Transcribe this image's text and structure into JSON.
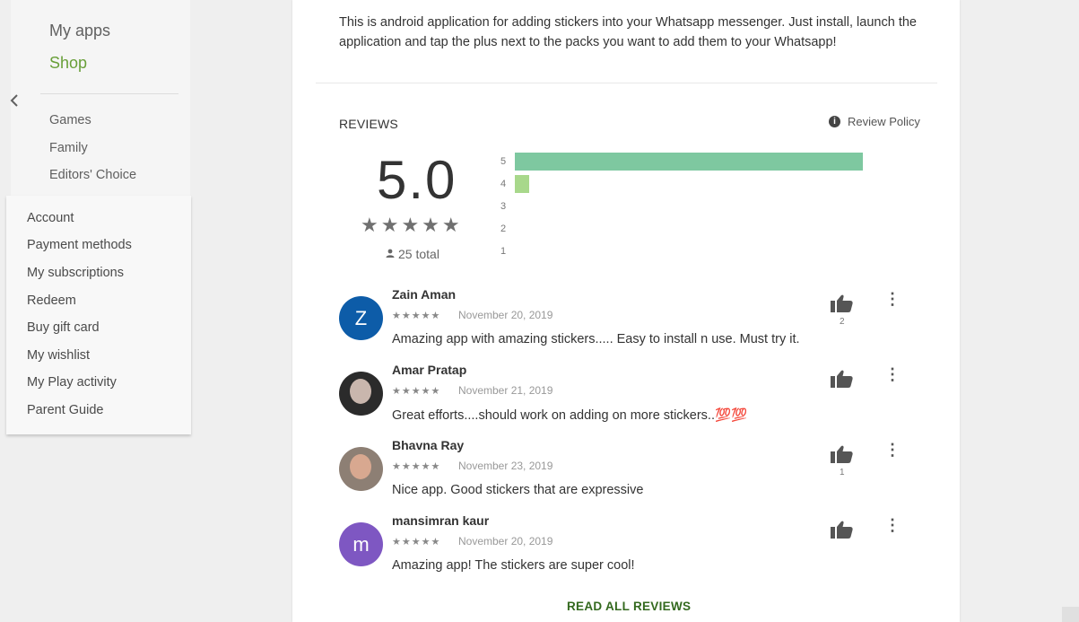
{
  "sidebar": {
    "primary": [
      {
        "label": "My apps"
      },
      {
        "label": "Shop"
      }
    ],
    "sub": [
      {
        "label": "Games"
      },
      {
        "label": "Family"
      },
      {
        "label": "Editors' Choice"
      }
    ],
    "menu": [
      {
        "label": "Account"
      },
      {
        "label": "Payment methods"
      },
      {
        "label": "My subscriptions"
      },
      {
        "label": "Redeem"
      },
      {
        "label": "Buy gift card"
      },
      {
        "label": "My wishlist"
      },
      {
        "label": "My Play activity"
      },
      {
        "label": "Parent Guide"
      }
    ],
    "shop_color": "#689f38"
  },
  "description": {
    "text": "This is android application for adding stickers into your Whatsapp messenger. Just install, launch the application and tap the plus next to the packs you want to add them to your Whatsapp!"
  },
  "reviews": {
    "heading": "REVIEWS",
    "policy_label": "Review Policy",
    "average": "5.0",
    "stars": "★★★★★",
    "total": "25 total",
    "histogram": [
      {
        "label": "5",
        "fraction": 0.96,
        "color": "#7ec8a0"
      },
      {
        "label": "4",
        "fraction": 0.04,
        "color": "#a8d88b"
      },
      {
        "label": "3",
        "fraction": 0,
        "color": "#ffd54f"
      },
      {
        "label": "2",
        "fraction": 0,
        "color": "#ffb74d"
      },
      {
        "label": "1",
        "fraction": 0,
        "color": "#ff8a65"
      }
    ],
    "items": [
      {
        "name": "Zain Aman",
        "initial": "Z",
        "avatar_color": "#0d5ca8",
        "stars": "★★★★★",
        "date": "November 20, 2019",
        "text": "Amazing app with amazing stickers..... Easy to install n use. Must try it.",
        "likes": "2"
      },
      {
        "name": "Amar Pratap",
        "initial": "",
        "avatar_color": "#2b2b2b",
        "stars": "★★★★★",
        "date": "November 21, 2019",
        "text": "Great efforts....should work on adding on more stickers..",
        "emoji": "💯💯",
        "likes": ""
      },
      {
        "name": "Bhavna Ray",
        "initial": "",
        "avatar_color": "#8d7f74",
        "stars": "★★★★★",
        "date": "November 23, 2019",
        "text": "Nice app. Good stickers that are expressive",
        "likes": "1"
      },
      {
        "name": "mansimran kaur",
        "initial": "m",
        "avatar_color": "#7e57c2",
        "stars": "★★★★★",
        "date": "November 20, 2019",
        "text": "Amazing app! The stickers are super cool!",
        "likes": ""
      }
    ],
    "read_all_label": "READ ALL REVIEWS",
    "accent_color": "#33691e"
  }
}
